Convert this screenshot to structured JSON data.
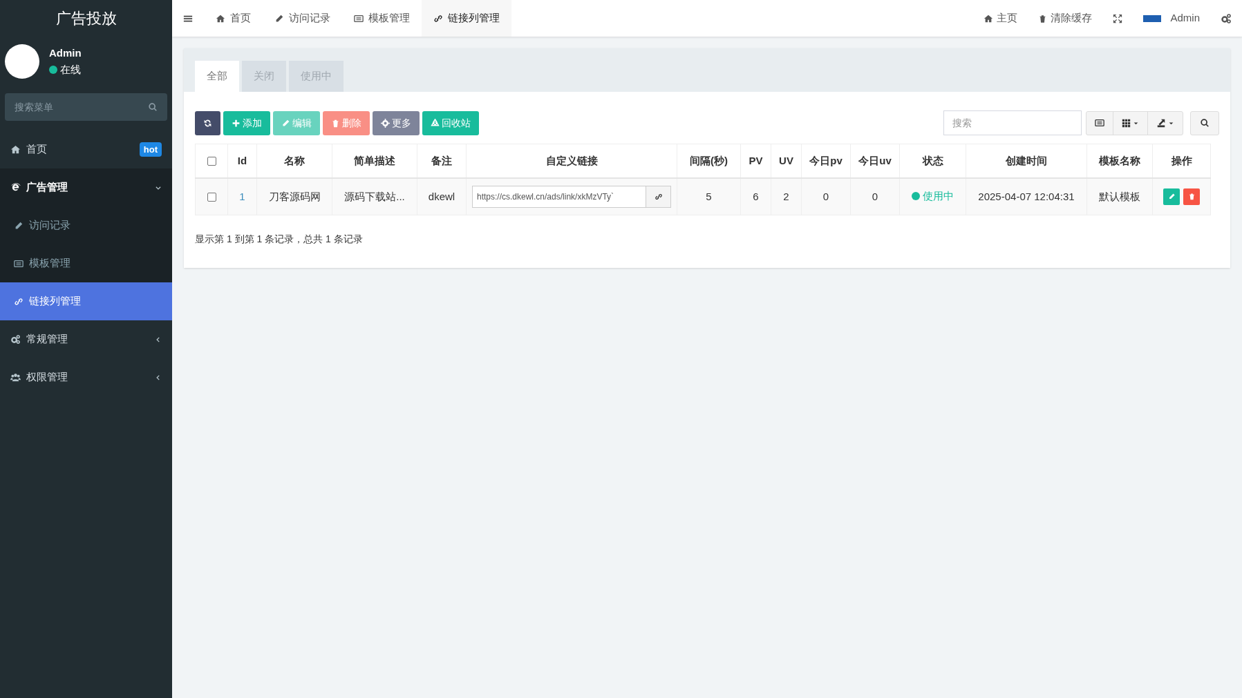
{
  "sidebar": {
    "title": "广告投放",
    "user": {
      "name": "Admin",
      "status": "在线",
      "online": true
    },
    "search": {
      "placeholder": "搜索菜单"
    },
    "items": [
      {
        "label": "首页",
        "badge": "hot",
        "selected": false,
        "expanded": false
      },
      {
        "label": "广告管理",
        "selected": false,
        "expanded": true,
        "children": [
          {
            "label": "访问记录",
            "selected": false
          },
          {
            "label": "模板管理",
            "selected": false
          },
          {
            "label": "链接列管理",
            "selected": true
          }
        ]
      },
      {
        "label": "常规管理",
        "selected": false,
        "expanded": false
      },
      {
        "label": "权限管理",
        "selected": false,
        "expanded": false
      }
    ]
  },
  "topbar": {
    "tabs": [
      {
        "label": "首页",
        "selected": false
      },
      {
        "label": "访问记录",
        "selected": false
      },
      {
        "label": "模板管理",
        "selected": false
      },
      {
        "label": "链接列管理",
        "selected": true
      }
    ],
    "right": [
      {
        "kind": "home",
        "label": "主页"
      },
      {
        "kind": "clear",
        "label": "清除缓存"
      },
      {
        "kind": "fullscreen"
      },
      {
        "kind": "user",
        "label": "Admin"
      },
      {
        "kind": "settings"
      }
    ]
  },
  "filter_tabs": [
    {
      "label": "全部",
      "selected": true
    },
    {
      "label": "关闭",
      "selected": false
    },
    {
      "label": "使用中",
      "selected": false
    }
  ],
  "toolbar": {
    "buttons": [
      {
        "kind": "refresh",
        "disabled": false
      },
      {
        "kind": "add",
        "label": "添加",
        "disabled": false
      },
      {
        "kind": "edit",
        "label": "编辑",
        "disabled": true
      },
      {
        "kind": "delete",
        "label": "删除",
        "disabled": true
      },
      {
        "kind": "more",
        "label": "更多",
        "disabled": false
      },
      {
        "kind": "recycle",
        "label": "回收站",
        "disabled": false
      }
    ],
    "search": {
      "placeholder": "搜索"
    }
  },
  "table": {
    "all_checked": false,
    "columns": [
      "Id",
      "名称",
      "简单描述",
      "备注",
      "自定义链接",
      "间隔(秒)",
      "PV",
      "UV",
      "今日pv",
      "今日uv",
      "状态",
      "创建时间",
      "模板名称",
      "操作"
    ],
    "rows": [
      {
        "checked": false,
        "id": "1",
        "name": "刀客源码网",
        "description": "源码下载站...",
        "remark": "dkewl",
        "link": "https://cs.dkewl.cn/ads/link/xkMzVTy`",
        "interval": "5",
        "pv": "6",
        "uv": "2",
        "today_pv": "0",
        "today_uv": "0",
        "status": {
          "label": "使用中",
          "color": "#18bc9c"
        },
        "created": "2025-04-07 12:04:31",
        "template": "默认模板"
      }
    ]
  },
  "pagination_info": "显示第 1 到第 1 条记录，总共 1 条记录"
}
